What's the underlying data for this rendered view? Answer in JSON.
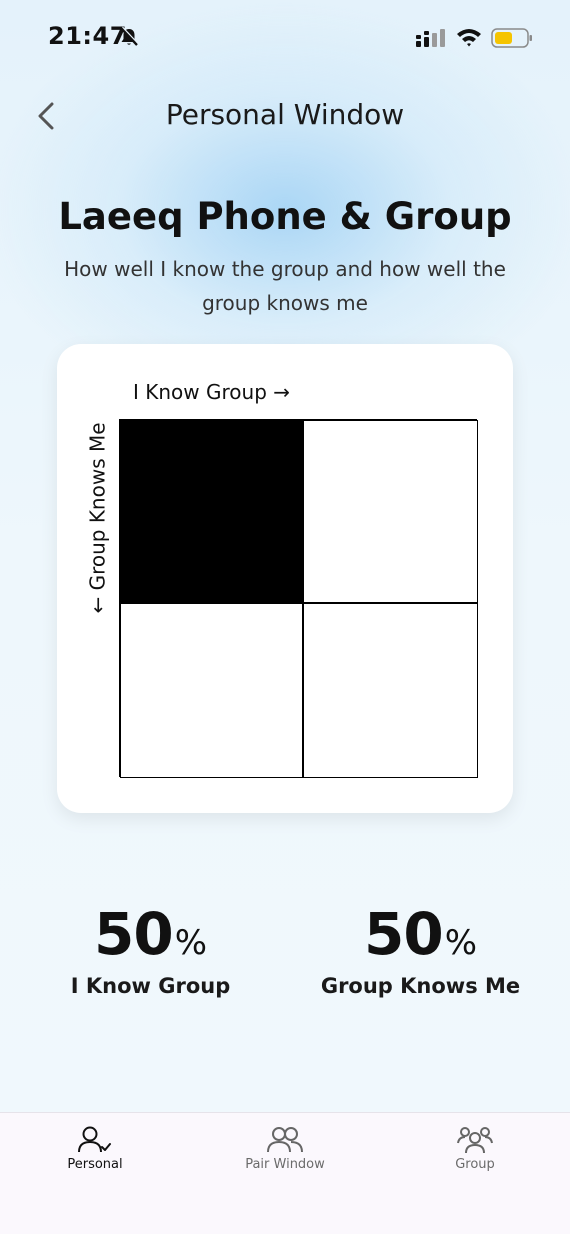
{
  "status_bar": {
    "time": "21:47"
  },
  "header": {
    "title": "Personal Window"
  },
  "content": {
    "group_title": "Laeeq Phone & Group",
    "subtitle": "How well I know the group and how well the group knows me"
  },
  "window_chart": {
    "x_axis_label": "I Know Group →",
    "y_axis_label": "← Group Knows Me",
    "cells": [
      {
        "position": "top-left",
        "filled": true
      },
      {
        "position": "top-right",
        "filled": false
      },
      {
        "position": "bottom-left",
        "filled": false
      },
      {
        "position": "bottom-right",
        "filled": false
      }
    ]
  },
  "stats": {
    "i_know_group": {
      "value": "50",
      "unit": "%",
      "label": "I Know Group"
    },
    "group_knows_me": {
      "value": "50",
      "unit": "%",
      "label": "Group Knows Me"
    }
  },
  "bottom_nav": {
    "items": [
      {
        "label": "Personal",
        "active": true
      },
      {
        "label": "Pair Window",
        "active": false
      },
      {
        "label": "Group",
        "active": false
      }
    ]
  },
  "colors": {
    "filled_cell": "#000000",
    "empty_cell": "#ffffff",
    "battery": "#f5c400"
  }
}
